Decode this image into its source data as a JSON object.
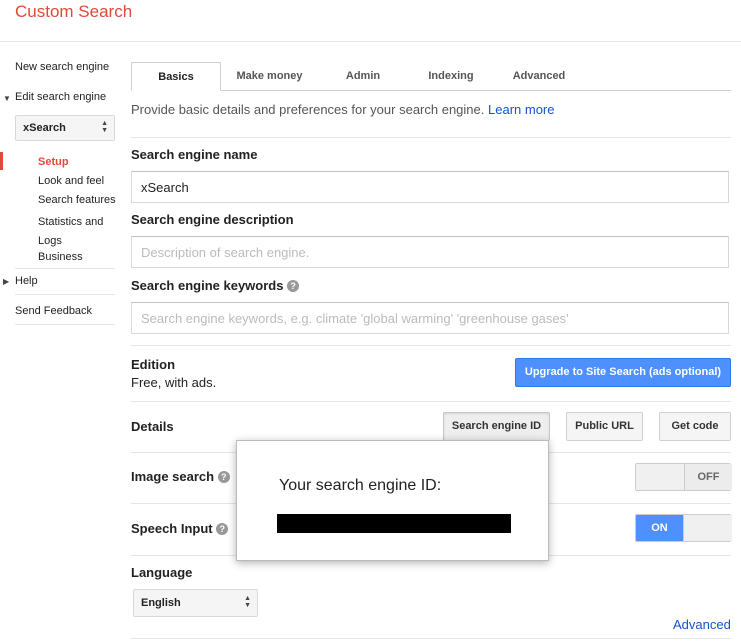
{
  "app": {
    "title": "Custom Search"
  },
  "sidebar": {
    "new_engine": "New search engine",
    "edit_engine": "Edit search engine",
    "engine_select": "xSearch",
    "sub_items": [
      "Setup",
      "Look and feel",
      "Search features",
      "Statistics and Logs",
      "Business"
    ],
    "help": "Help",
    "feedback": "Send Feedback"
  },
  "tabs": [
    "Basics",
    "Make money",
    "Admin",
    "Indexing",
    "Advanced"
  ],
  "intro": {
    "text": "Provide basic details and preferences for your search engine.",
    "link": "Learn more"
  },
  "name": {
    "label": "Search engine name",
    "value": "xSearch"
  },
  "description": {
    "label": "Search engine description",
    "placeholder": "Description of search engine."
  },
  "keywords": {
    "label": "Search engine keywords",
    "placeholder": "Search engine keywords, e.g. climate 'global warming' 'greenhouse gases'"
  },
  "edition": {
    "label": "Edition",
    "value": "Free, with ads.",
    "upgrade_button": "Upgrade to Site Search (ads optional)"
  },
  "details": {
    "label": "Details",
    "buttons": [
      "Search engine ID",
      "Public URL",
      "Get code"
    ]
  },
  "image_search": {
    "label": "Image search",
    "state": "OFF"
  },
  "speech_input": {
    "label": "Speech Input",
    "state": "ON"
  },
  "language": {
    "label": "Language",
    "value": "English"
  },
  "advanced_link": "Advanced",
  "popup": {
    "title": "Your search engine ID:"
  },
  "colors": {
    "brand": "#dd4b39",
    "link": "#1155cc",
    "primary_button": "#4d90fe"
  }
}
